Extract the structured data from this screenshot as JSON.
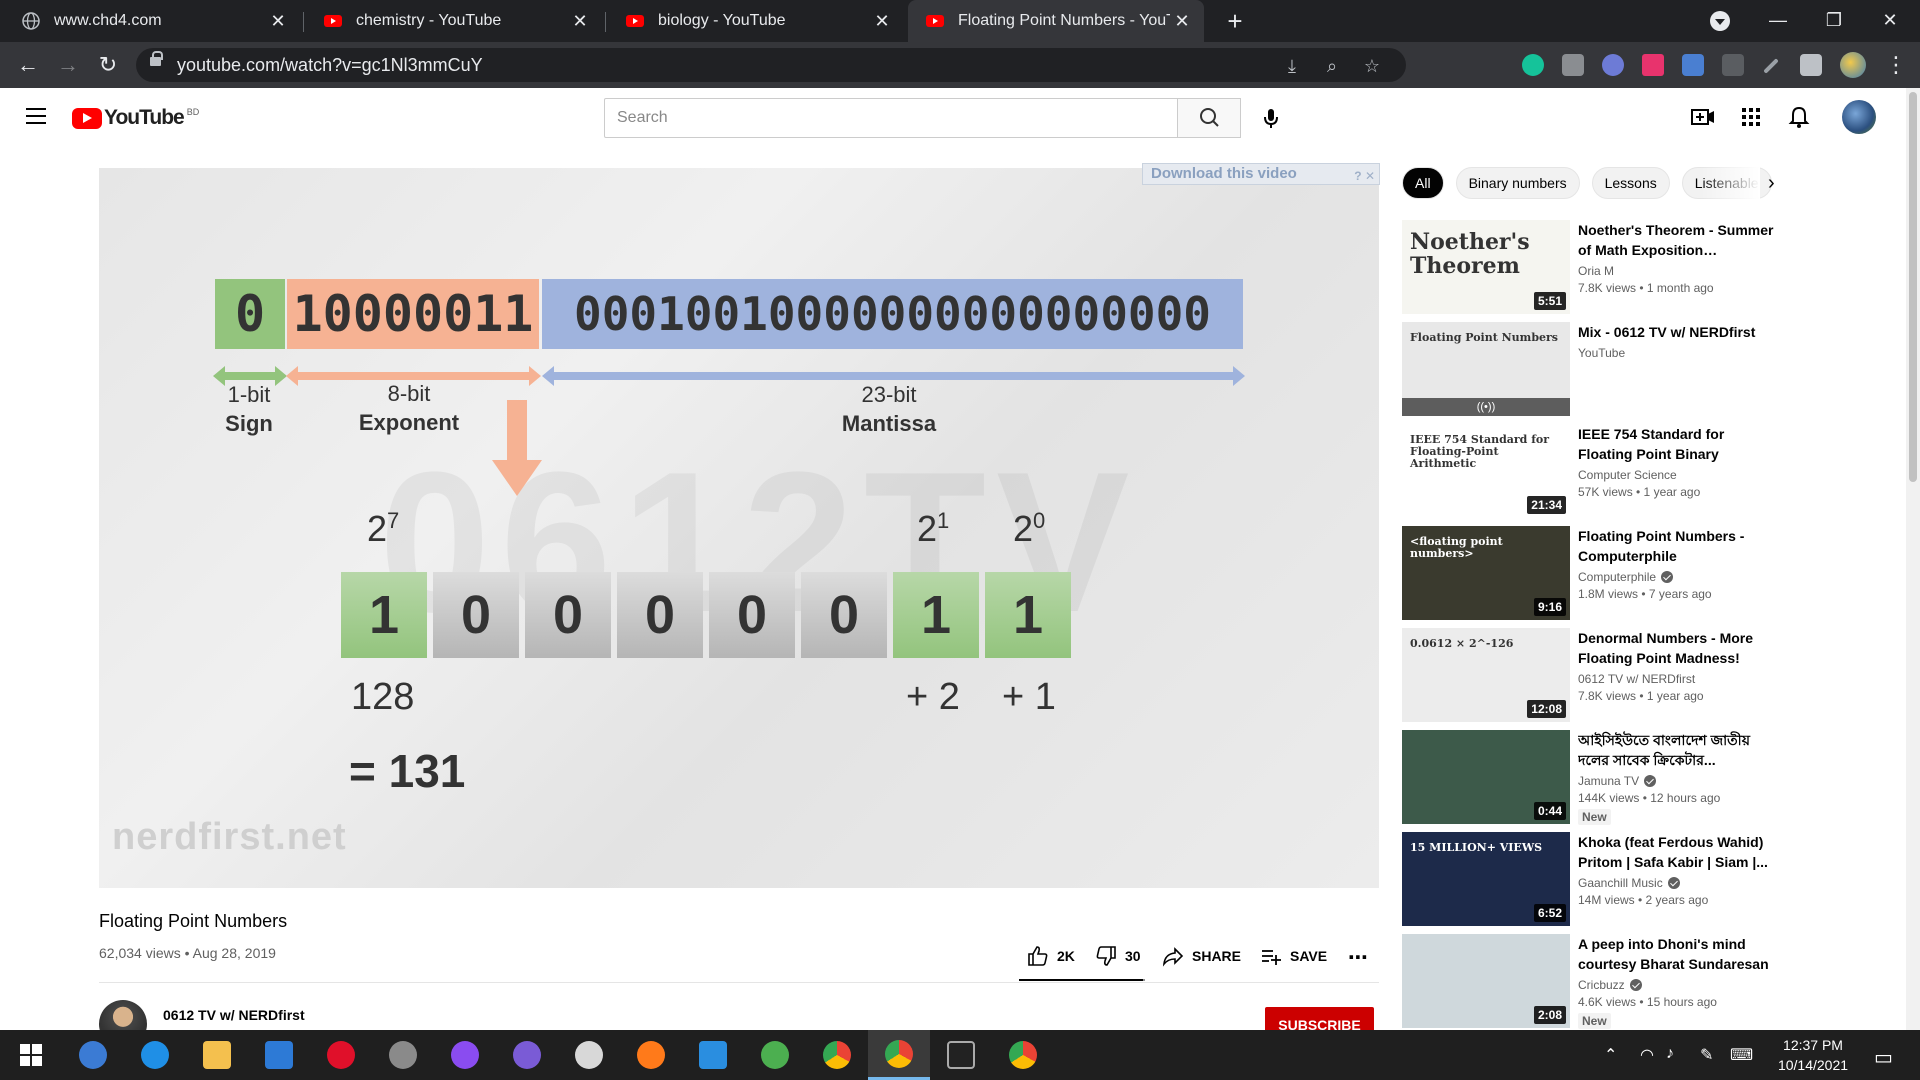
{
  "browser": {
    "tabs": [
      {
        "title": "www.chd4.com",
        "active": false,
        "favicon": "globe-icon"
      },
      {
        "title": "chemistry - YouTube",
        "active": false,
        "favicon": "youtube-icon"
      },
      {
        "title": "biology - YouTube",
        "active": false,
        "favicon": "youtube-icon"
      },
      {
        "title": "Floating Point Numbers - YouTube",
        "active": true,
        "favicon": "youtube-icon"
      }
    ],
    "url": "youtube.com/watch?v=gc1Nl3mmCuY",
    "window_controls": {
      "minimize": "—",
      "restore": "❐",
      "close": "✕"
    }
  },
  "youtube": {
    "logo_text": "YouTube",
    "country": "BD",
    "search_placeholder": "Search"
  },
  "player": {
    "download_label": "Download this video",
    "download_controls": "? ✕",
    "watermark": "nerdfirst.net",
    "sign_bits": "0",
    "exponent_bits": "10000011",
    "mantissa_bits": "00010010000000000000000",
    "labels": {
      "sign_count": "1-bit",
      "sign_name": "Sign",
      "exponent_count": "8-bit",
      "exponent_name": "Exponent",
      "mantissa_count": "23-bit",
      "mantissa_name": "Mantissa"
    },
    "powers": [
      {
        "base": "2",
        "exp": "7"
      },
      {
        "base": "2",
        "exp": "1"
      },
      {
        "base": "2",
        "exp": "0"
      }
    ],
    "cells": [
      {
        "bit": "1",
        "on": true
      },
      {
        "bit": "0",
        "on": false
      },
      {
        "bit": "0",
        "on": false
      },
      {
        "bit": "0",
        "on": false
      },
      {
        "bit": "0",
        "on": false
      },
      {
        "bit": "0",
        "on": false
      },
      {
        "bit": "1",
        "on": true
      },
      {
        "bit": "1",
        "on": true
      }
    ],
    "values": [
      "128",
      "+ 2",
      "+ 1"
    ],
    "total": "= 131",
    "colors": {
      "sign": "#93c47d",
      "exponent": "#f6b293",
      "mantissa": "#9fb3dd"
    }
  },
  "video": {
    "title": "Floating Point Numbers",
    "meta": "62,034 views • Aug 28, 2019",
    "likes": "2K",
    "dislikes": "30",
    "like_ratio": 0.985,
    "share_label": "SHARE",
    "save_label": "SAVE",
    "more_label": "⋯",
    "channel": "0612 TV w/ NERDfirst",
    "subscribe_label": "SUBSCRIBE"
  },
  "chips": [
    "All",
    "Binary numbers",
    "Lessons",
    "Listenable"
  ],
  "recommendations": [
    {
      "title": "Noether's Theorem - Summer of Math Exposition…",
      "channel": "Oria M",
      "verified": false,
      "meta": "7.8K views • 1 month ago",
      "duration": "5:51",
      "badge": "",
      "thumb_text": "Noether's Theorem",
      "thumb_bg": "#f5f5f0"
    },
    {
      "title": "Mix - 0612 TV w/ NERDfirst",
      "channel": "YouTube",
      "verified": false,
      "meta": "",
      "duration": "",
      "badge": "",
      "thumb_text": "Floating Point Numbers",
      "thumb_bg": "#e8e8e8"
    },
    {
      "title": "IEEE 754 Standard for Floating Point Binary Arithmetic",
      "channel": "Computer Science",
      "verified": false,
      "meta": "57K views • 1 year ago",
      "duration": "21:34",
      "badge": "",
      "thumb_text": "IEEE 754 Standard for Floating-Point Arithmetic",
      "thumb_bg": "#ffffff"
    },
    {
      "title": "Floating Point Numbers - Computerphile",
      "channel": "Computerphile",
      "verified": true,
      "meta": "1.8M views • 7 years ago",
      "duration": "9:16",
      "badge": "",
      "thumb_text": "<floating point numbers>",
      "thumb_bg": "#3a3a2e"
    },
    {
      "title": "Denormal Numbers - More Floating Point Madness!",
      "channel": "0612 TV w/ NERDfirst",
      "verified": false,
      "meta": "7.8K views • 1 year ago",
      "duration": "12:08",
      "badge": "",
      "thumb_text": "0.0612 × 2^-126",
      "thumb_bg": "#ececec"
    },
    {
      "title": "আইসিইউতে বাংলাদেশ জাতীয় দলের সাবেক ক্রিকেটার...",
      "channel": "Jamuna TV",
      "verified": true,
      "meta": "144K views • 12 hours ago",
      "duration": "0:44",
      "badge": "New",
      "thumb_text": "",
      "thumb_bg": "#3d5a4a"
    },
    {
      "title": "Khoka (feat Ferdous Wahid) Pritom | Safa Kabir | Siam |...",
      "channel": "Gaanchill Music",
      "verified": true,
      "meta": "14M views • 2 years ago",
      "duration": "6:52",
      "badge": "",
      "thumb_text": "15 MILLION+ VIEWS",
      "thumb_bg": "#1d2a4a"
    },
    {
      "title": "A peep into Dhoni's mind courtesy Bharat Sundaresan",
      "channel": "Cricbuzz",
      "verified": true,
      "meta": "4.6K views • 15 hours ago",
      "duration": "2:08",
      "badge": "New",
      "thumb_text": "",
      "thumb_bg": "#cfd8dc"
    }
  ],
  "taskbar": {
    "time": "12:37 PM",
    "date": "10/14/2021"
  }
}
